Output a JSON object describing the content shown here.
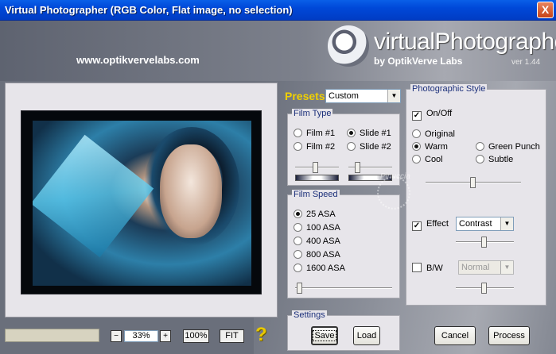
{
  "window": {
    "title": "Virtual Photographer (RGB Color, Flat image, no selection)",
    "close_label": "X"
  },
  "header": {
    "website": "www.optikvervelabs.com",
    "brand": "virtualPhotographer",
    "brand_sub": "by OptikVerve Labs",
    "version": "ver 1.44"
  },
  "zoom": {
    "minus": "−",
    "value": "33%",
    "plus": "+",
    "actual_label": "100%",
    "fit_label": "FIT",
    "help": "?"
  },
  "presets": {
    "label": "Presets",
    "selected": "Custom"
  },
  "film_type": {
    "title": "Film Type",
    "options": [
      {
        "label": "Film #1",
        "selected": false
      },
      {
        "label": "Slide #1",
        "selected": true
      },
      {
        "label": "Film #2",
        "selected": false
      },
      {
        "label": "Slide #2",
        "selected": false
      }
    ],
    "slider_left": 0.48,
    "slider_right": 0.18
  },
  "film_speed": {
    "title": "Film Speed",
    "options": [
      {
        "label": "25 ASA",
        "selected": true
      },
      {
        "label": "100 ASA",
        "selected": false
      },
      {
        "label": "400 ASA",
        "selected": false
      },
      {
        "label": "800 ASA",
        "selected": false
      },
      {
        "label": "1600 ASA",
        "selected": false
      }
    ],
    "slider": 0.02
  },
  "settings": {
    "title": "Settings",
    "save_label": "Save",
    "load_label": "Load"
  },
  "photographic_style": {
    "title": "Photographic Style",
    "onoff_label": "On/Off",
    "onoff_checked": true,
    "styles": [
      {
        "label": "Original",
        "selected": false
      },
      {
        "label": "Warm",
        "selected": true
      },
      {
        "label": "Green Punch",
        "selected": false
      },
      {
        "label": "Cool",
        "selected": false
      },
      {
        "label": "Subtle",
        "selected": false
      }
    ],
    "style_slider": 0.5,
    "effect_label": "Effect",
    "effect_checked": true,
    "effect_selected": "Contrast",
    "effect_slider": 0.5,
    "bw_label": "B/W",
    "bw_checked": false,
    "bw_selected": "Normal",
    "bw_slider": 0.5
  },
  "watermark": "Pinuccia",
  "actions": {
    "cancel_label": "Cancel",
    "process_label": "Process"
  }
}
